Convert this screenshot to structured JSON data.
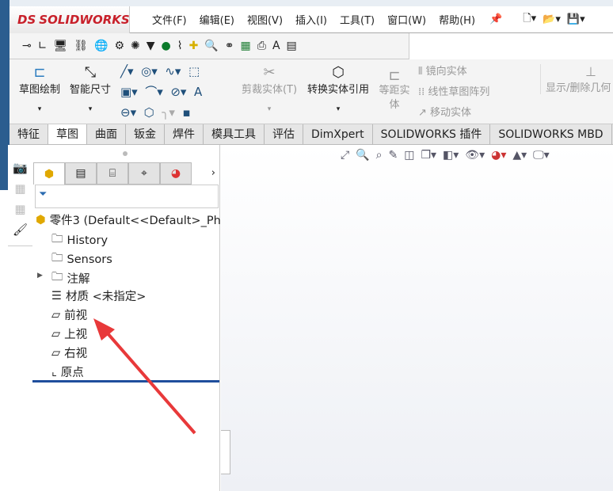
{
  "app": {
    "logo": "SOLIDWORKS",
    "logo_prefix": "DS"
  },
  "menu": [
    "文件(F)",
    "编辑(E)",
    "视图(V)",
    "插入(I)",
    "工具(T)",
    "窗口(W)",
    "帮助(H)"
  ],
  "ribbon": {
    "sketch": "草图绘制",
    "smart_dim": "智能尺寸",
    "trim": "剪裁实体(T)",
    "convert": "转换实体引用",
    "offset": "等距实体",
    "mirror": "镜向实体",
    "linear_pattern": "线性草图阵列",
    "move": "移动实体",
    "show_delete": "显示/删除几何"
  },
  "tabs": [
    {
      "label": "特征",
      "active": false
    },
    {
      "label": "草图",
      "active": true
    },
    {
      "label": "曲面",
      "active": false
    },
    {
      "label": "钣金",
      "active": false
    },
    {
      "label": "焊件",
      "active": false
    },
    {
      "label": "模具工具",
      "active": false
    },
    {
      "label": "评估",
      "active": false
    },
    {
      "label": "DimXpert",
      "active": false
    },
    {
      "label": "SOLIDWORKS 插件",
      "active": false
    },
    {
      "label": "SOLIDWORKS MBD",
      "active": false
    }
  ],
  "tree": {
    "root": "零件3  (Default<<Default>_Ph",
    "items": [
      "History",
      "Sensors",
      "注解",
      "材质 <未指定>",
      "前视",
      "上视",
      "右视",
      "原点"
    ]
  },
  "colors": {
    "accent": "#c8202a",
    "selection_line": "#1f4e9c",
    "arrow": "#e8393a"
  }
}
